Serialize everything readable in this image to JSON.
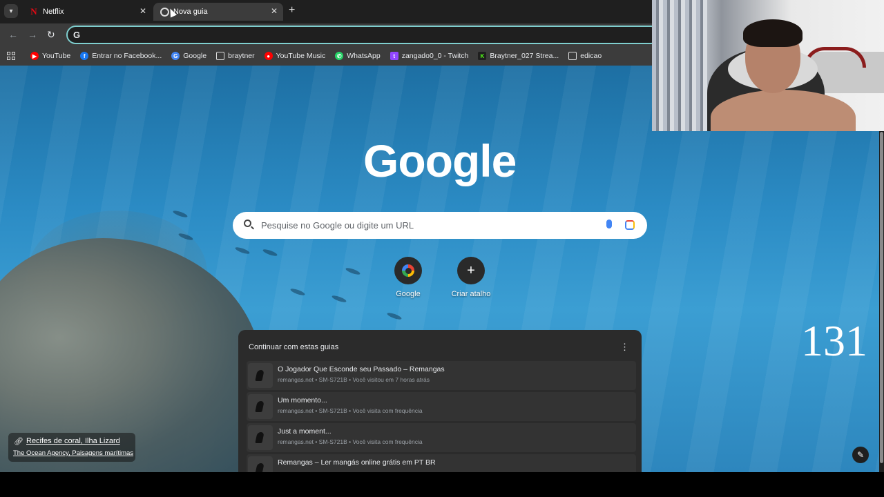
{
  "tabs": [
    {
      "title": "Netflix",
      "active": false
    },
    {
      "title": "Nova guia",
      "active": true
    }
  ],
  "bookmarks": [
    {
      "label": "YouTube",
      "icon": "youtube-icon",
      "color": "#ff0000"
    },
    {
      "label": "Entrar no Facebook...",
      "icon": "facebook-icon",
      "color": "#1877f2"
    },
    {
      "label": "Google",
      "icon": "google-icon",
      "color": "#4285f4"
    },
    {
      "label": "braytner",
      "icon": "folder-icon",
      "color": "#e8eaed"
    },
    {
      "label": "YouTube Music",
      "icon": "youtube-music-icon",
      "color": "#ff0000"
    },
    {
      "label": "WhatsApp",
      "icon": "whatsapp-icon",
      "color": "#25d366"
    },
    {
      "label": "zangado0_0 - Twitch",
      "icon": "twitch-icon",
      "color": "#9146ff"
    },
    {
      "label": "Braytner_027 Strea...",
      "icon": "kick-icon",
      "color": "#53fc18"
    },
    {
      "label": "edicao",
      "icon": "folder-icon",
      "color": "#e8eaed"
    }
  ],
  "page": {
    "logo": "Google",
    "search_placeholder": "Pesquise no Google ou digite um URL",
    "shortcuts": [
      {
        "label": "Google"
      },
      {
        "label": "Criar atalho"
      }
    ],
    "continue_panel": {
      "title": "Continuar com estas guias",
      "items": [
        {
          "title": "O Jogador Que Esconde seu Passado – Remangas",
          "meta": "remangas.net • SM-S721B • Você visitou em 7 horas atrás"
        },
        {
          "title": "Um momento...",
          "meta": "remangas.net • SM-S721B • Você visita com frequência"
        },
        {
          "title": "Just a moment...",
          "meta": "remangas.net • SM-S721B • Você visita com frequência"
        },
        {
          "title": "Remangas – Ler mangás online grátis em PT BR",
          "meta": ""
        }
      ]
    },
    "attribution": {
      "title": "Recifes de coral, Ilha Lizard",
      "credit": "The Ocean Agency, Paisagens marítimas"
    },
    "counter": "131"
  },
  "colors": {
    "omnibox_border": "#7fcfcf",
    "tabstrip": "#1f1f1f",
    "toolbar": "#3c3c3c"
  }
}
